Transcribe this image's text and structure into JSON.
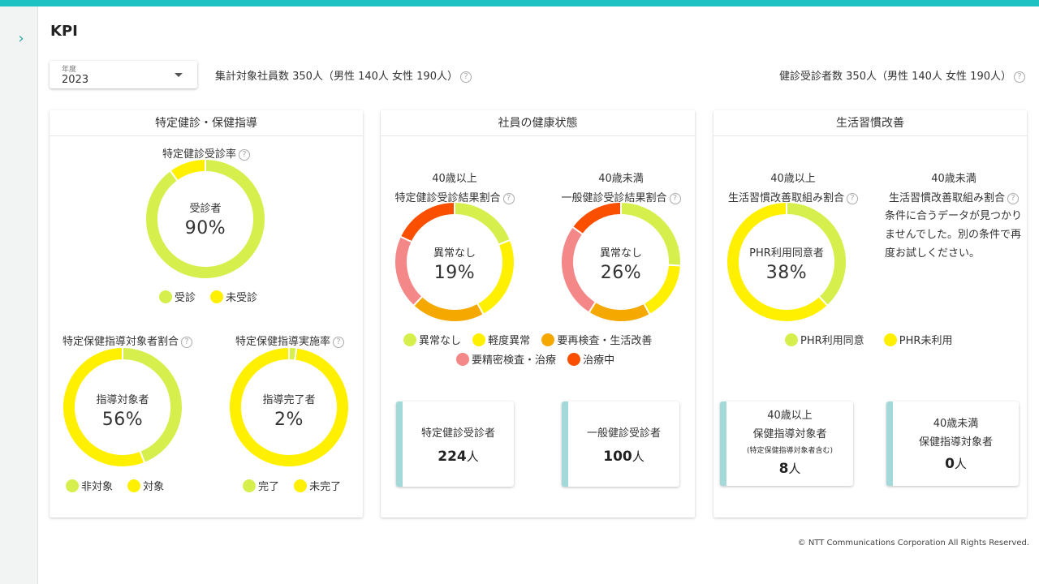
{
  "page": {
    "title": "KPI"
  },
  "filter": {
    "label": "年度",
    "value": "2023"
  },
  "summary": {
    "left": "集計対象社員数 350人（男性 140人 女性 190人）",
    "right": "健診受診者数 350人（男性 140人 女性 190人）",
    "help_glyph": "?"
  },
  "colors": {
    "accent": "#1fc2c2",
    "green": "#d7ef4d",
    "yellow": "#fff000",
    "orange": "#f5a800",
    "pink": "#f48787",
    "red": "#fb4f00",
    "stat_bar": "#a4d9d9"
  },
  "cards": {
    "tokutei": {
      "title": "特定健診・保健指導",
      "rate": {
        "title": "特定健診受診率",
        "center_label": "受診者",
        "center_value": "90%",
        "legend": [
          "受診",
          "未受診"
        ]
      },
      "target": {
        "title": "特定保健指導対象者割合",
        "center_label": "指導対象者",
        "center_value": "56%",
        "legend": [
          "非対象",
          "対象"
        ]
      },
      "done": {
        "title": "特定保健指導実施率",
        "center_label": "指導完了者",
        "center_value": "2%",
        "legend": [
          "完了",
          "未完了"
        ]
      }
    },
    "health": {
      "title": "社員の健康状態",
      "over40": {
        "title1": "40歳以上",
        "title2": "特定健診受診結果割合",
        "center_label": "異常なし",
        "center_value": "19%"
      },
      "under40": {
        "title1": "40歳未満",
        "title2": "一般健診受診結果割合",
        "center_label": "異常なし",
        "center_value": "26%"
      },
      "legend_row1": [
        "異常なし",
        "軽度異常",
        "要再検査・生活改善"
      ],
      "legend_row2": [
        "要精密検査・治療",
        "治療中"
      ],
      "stat1": {
        "label": "特定健診受診者",
        "value": "224",
        "unit": "人"
      },
      "stat2": {
        "label": "一般健診受診者",
        "value": "100",
        "unit": "人"
      }
    },
    "lifestyle": {
      "title": "生活習慣改善",
      "over40": {
        "title1": "40歳以上",
        "title2": "生活習慣改善取組み割合",
        "center_label": "PHR利用同意者",
        "center_value": "38%"
      },
      "under40": {
        "title1": "40歳未満",
        "title2": "生活習慣改善取組み割合",
        "no_data": "条件に合うデータが見つかりませんでした。別の条件で再度お試しください。"
      },
      "legend": [
        "PHR利用同意",
        "PHR未利用"
      ],
      "stat1": {
        "line1": "40歳以上",
        "line2": "保健指導対象者",
        "sub": "(特定保健指導対象者含む)",
        "value": "8",
        "unit": "人"
      },
      "stat2": {
        "line1": "40歳未満",
        "line2": "保健指導対象者",
        "value": "0",
        "unit": "人"
      }
    }
  },
  "chart_data": [
    {
      "type": "pie",
      "title": "特定健診受診率",
      "categories": [
        "受診",
        "未受診"
      ],
      "values": [
        90,
        10
      ]
    },
    {
      "type": "pie",
      "title": "特定保健指導対象者割合",
      "categories": [
        "非対象",
        "対象"
      ],
      "values": [
        44,
        56
      ]
    },
    {
      "type": "pie",
      "title": "特定保健指導実施率",
      "categories": [
        "完了",
        "未完了"
      ],
      "values": [
        2,
        98
      ]
    },
    {
      "type": "pie",
      "title": "特定健診受診結果割合",
      "categories": [
        "異常なし",
        "軽度異常",
        "要再検査・生活改善",
        "要精密検査・治療",
        "治療中"
      ],
      "values": [
        19,
        23,
        20,
        20,
        18
      ]
    },
    {
      "type": "pie",
      "title": "一般健診受診結果割合",
      "categories": [
        "異常なし",
        "軽度異常",
        "要再検査・生活改善",
        "要精密検査・治療",
        "治療中"
      ],
      "values": [
        26,
        16,
        17,
        26,
        15
      ]
    },
    {
      "type": "pie",
      "title": "生活習慣改善取組み割合",
      "categories": [
        "PHR利用同意",
        "PHR未利用"
      ],
      "values": [
        38,
        62
      ]
    }
  ],
  "footer": "© NTT Communications Corporation All Rights Reserved."
}
